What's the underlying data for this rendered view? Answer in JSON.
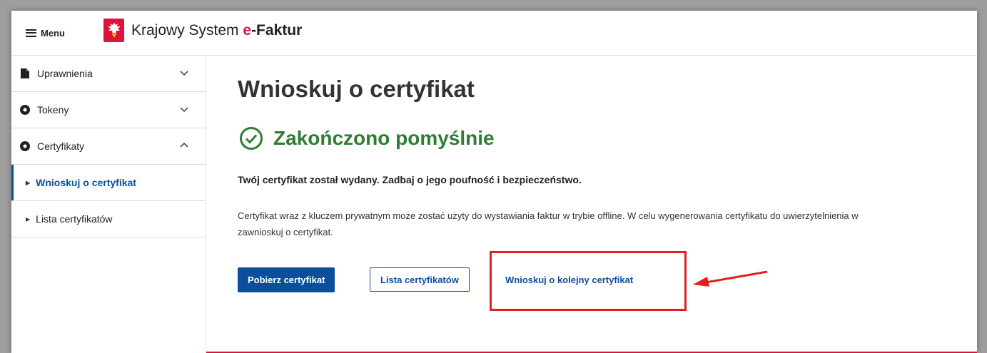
{
  "header": {
    "menu_label": "Menu",
    "brand_prefix": "Krajowy System ",
    "brand_e": "e",
    "brand_suffix": "-Faktur",
    "logo_icon": "polish-eagle-emblem-icon"
  },
  "sidebar": {
    "items": [
      {
        "label": "Uprawnienia",
        "icon": "document-icon",
        "chevron": "chevron-down-icon"
      },
      {
        "label": "Tokeny",
        "icon": "circle-dot-icon",
        "chevron": "chevron-down-icon"
      },
      {
        "label": "Certyfikaty",
        "icon": "circle-dot-icon",
        "chevron": "chevron-up-icon"
      }
    ],
    "subitems": [
      {
        "label": "Wnioskuj o certyfikat",
        "active": true
      },
      {
        "label": "Lista certyfikatów",
        "active": false
      }
    ]
  },
  "main": {
    "title": "Wnioskuj o certyfikat",
    "success_text": "Zakończono pomyślnie",
    "lead": "Twój certyfikat został wydany. Zadbaj o jego poufność i bezpieczeństwo.",
    "body_line1": "Certyfikat wraz z kluczem prywatnym może zostać użyty do wystawiania faktur w trybie offline. W celu wygenerowania certyfikatu do uwierzytelnienia w",
    "body_line2": "zawnioskuj o certyfikat.",
    "buttons": {
      "download": "Pobierz certyfikat",
      "list": "Lista certyfikatów",
      "request_next": "Wnioskuj o kolejny certyfikat"
    }
  },
  "colors": {
    "primary": "#0b4f9c",
    "success": "#2e7d32",
    "brand_red": "#dc143c",
    "annotation_red": "#e02020"
  }
}
